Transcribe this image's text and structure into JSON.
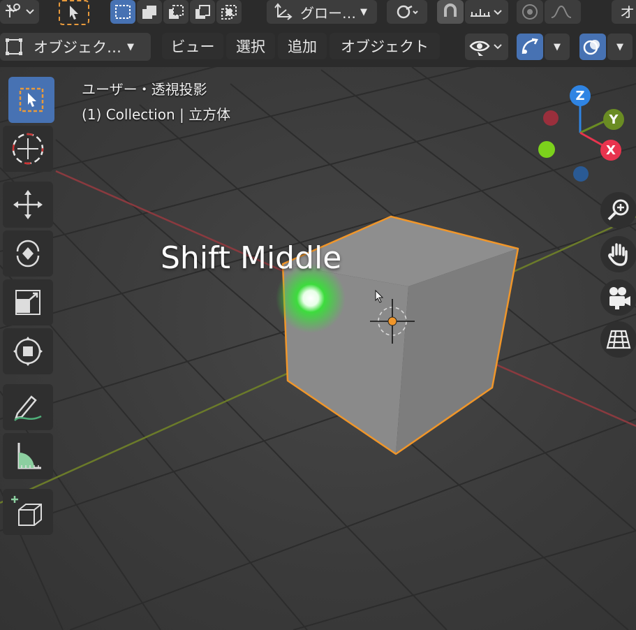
{
  "topbar": {
    "transform_orientation": "グロー…",
    "cutoff_right": "オ"
  },
  "header": {
    "mode_select": "オブジェク…",
    "menu": [
      "ビュー",
      "選択",
      "追加",
      "オブジェクト"
    ]
  },
  "viewport": {
    "view_name": "ユーザー・透視投影",
    "collection_info": "(1) Collection | 立方体",
    "caption": "Shift Middle"
  },
  "gizmo": {
    "z": "Z",
    "y": "Y",
    "x": "X",
    "colors": {
      "x": "#e8344e",
      "y": "#6a8c23",
      "z": "#2f84e3"
    }
  },
  "icons": {
    "toolbar": [
      "select-box-icon",
      "cursor-icon",
      "move-icon",
      "rotate-icon",
      "scale-icon",
      "transform-icon",
      "annotate-icon",
      "measure-icon",
      "add-cube-icon"
    ],
    "nav": [
      "zoom-icon",
      "hand-icon",
      "camera-icon",
      "grid-icon"
    ]
  },
  "colors": {
    "accent": "#4772b3",
    "selection_outline": "#f0962a",
    "header_bg": "#2b2b2b",
    "viewport_bg": "#3a3a3a"
  }
}
